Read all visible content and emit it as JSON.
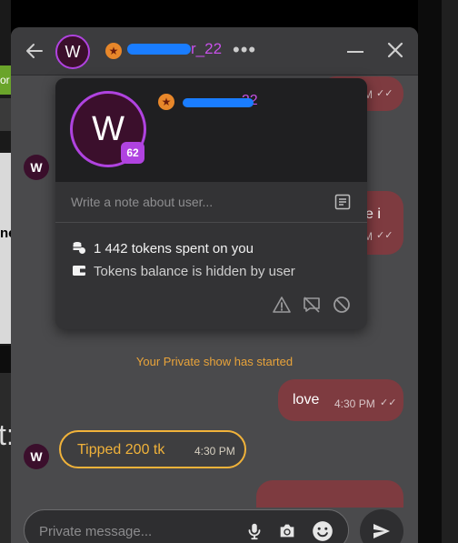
{
  "background": {
    "left_fragment_green": "or",
    "left_fragment_text": "ne",
    "left_fragment_large": "t:"
  },
  "header": {
    "avatar_letter": "W",
    "username": "r_22",
    "icons": [
      "arrow-left-icon",
      "star-badge-icon",
      "more-dots-icon",
      "minimize-icon",
      "close-icon"
    ]
  },
  "popover": {
    "avatar_letter": "W",
    "level": "62",
    "username": "_22",
    "note_placeholder": "Write a note about user...",
    "tokens_spent": "1 442 tokens spent on you",
    "tokens_balance": "Tokens balance is hidden by user",
    "icons": [
      "note-icon",
      "report-icon",
      "hide-chat-icon",
      "block-icon"
    ]
  },
  "messages": {
    "top_time_partial": "M",
    "mid_text_partial": "e i",
    "mid_time_partial": "M",
    "system": "Your Private show has started",
    "love_text": "love",
    "love_time": "4:30 PM",
    "tip_text": "Tipped 200 tk",
    "tip_time": "4:30 PM",
    "small_avatar_letter": "W"
  },
  "composer": {
    "placeholder": "Private message...",
    "icons": [
      "microphone-icon",
      "camera-icon",
      "emoji-icon",
      "send-icon"
    ]
  },
  "colors": {
    "accent_purple": "#b043e0",
    "outgoing_bubble": "#7e3b40",
    "tip_gold": "#f0b23a",
    "system_orange": "#e8a33a"
  }
}
